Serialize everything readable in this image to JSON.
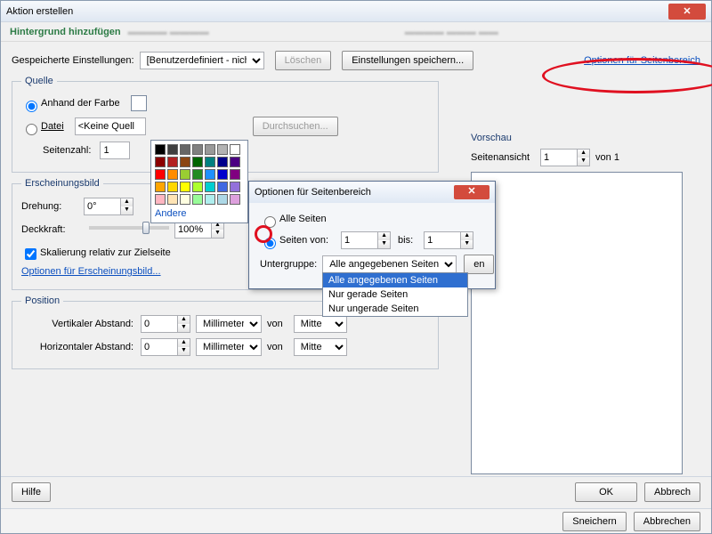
{
  "window": {
    "title": "Aktion erstellen"
  },
  "subheader": {
    "text": "Hintergrund hinzufügen"
  },
  "saved": {
    "label": "Gespeicherte Einstellungen:",
    "select_value": "[Benutzerdefiniert - nich",
    "delete": "Löschen",
    "save": "Einstellungen speichern...",
    "options_link": "Optionen für Seitenbereich"
  },
  "source": {
    "legend": "Quelle",
    "by_color": "Anhand der Farbe",
    "file": "Datei",
    "file_value": "<Keine Quell",
    "browse": "Durchsuchen...",
    "page_count_label": "Seitenzahl:",
    "page_count_value": "1",
    "color_more": "Andere"
  },
  "appearance": {
    "legend": "Erscheinungsbild",
    "rotation_label": "Drehung:",
    "rotation_value": "0°",
    "opacity_label": "Deckkraft:",
    "opacity_value": "100%",
    "scale_check": "Skalierung relativ zur Zielseite",
    "options_link": "Optionen für Erscheinungsbild..."
  },
  "position": {
    "legend": "Position",
    "vert_label": "Vertikaler Abstand:",
    "horiz_label": "Horizontaler Abstand:",
    "value": "0",
    "unit": "Millimeter",
    "from": "von",
    "anchor": "Mitte"
  },
  "preview": {
    "legend": "Vorschau",
    "page_view": "Seitenansicht",
    "page_val": "1",
    "of": "von 1"
  },
  "modal": {
    "title": "Optionen für Seitenbereich",
    "all_pages": "Alle Seiten",
    "pages_from": "Seiten von:",
    "from_val": "1",
    "to_label": "bis:",
    "to_val": "1",
    "subset_label": "Untergruppe:",
    "subset_value": "Alle angegebenen Seiten",
    "options": [
      "Alle angegebenen Seiten",
      "Nur gerade Seiten",
      "Nur ungerade Seiten"
    ],
    "ok_tail": "en"
  },
  "footer": {
    "help": "Hilfe",
    "ok": "OK",
    "cancel": "Abbrech"
  },
  "footer2": {
    "save": "Sneichern",
    "cancel": "Abbrechen"
  },
  "colors": [
    "#000000",
    "#404040",
    "#666666",
    "#808080",
    "#999999",
    "#b3b3b3",
    "#ffffff",
    "#8b0000",
    "#b22222",
    "#8b4513",
    "#006400",
    "#008080",
    "#00008b",
    "#4b0082",
    "#ff0000",
    "#ff8c00",
    "#9acd32",
    "#228b22",
    "#1e90ff",
    "#0000cd",
    "#800080",
    "#ffa500",
    "#ffd700",
    "#ffff00",
    "#adff2f",
    "#00ced1",
    "#4169e1",
    "#9370db",
    "#ffb6c1",
    "#ffe4b5",
    "#ffffe0",
    "#98fb98",
    "#afeeee",
    "#add8e6",
    "#dda0dd"
  ]
}
